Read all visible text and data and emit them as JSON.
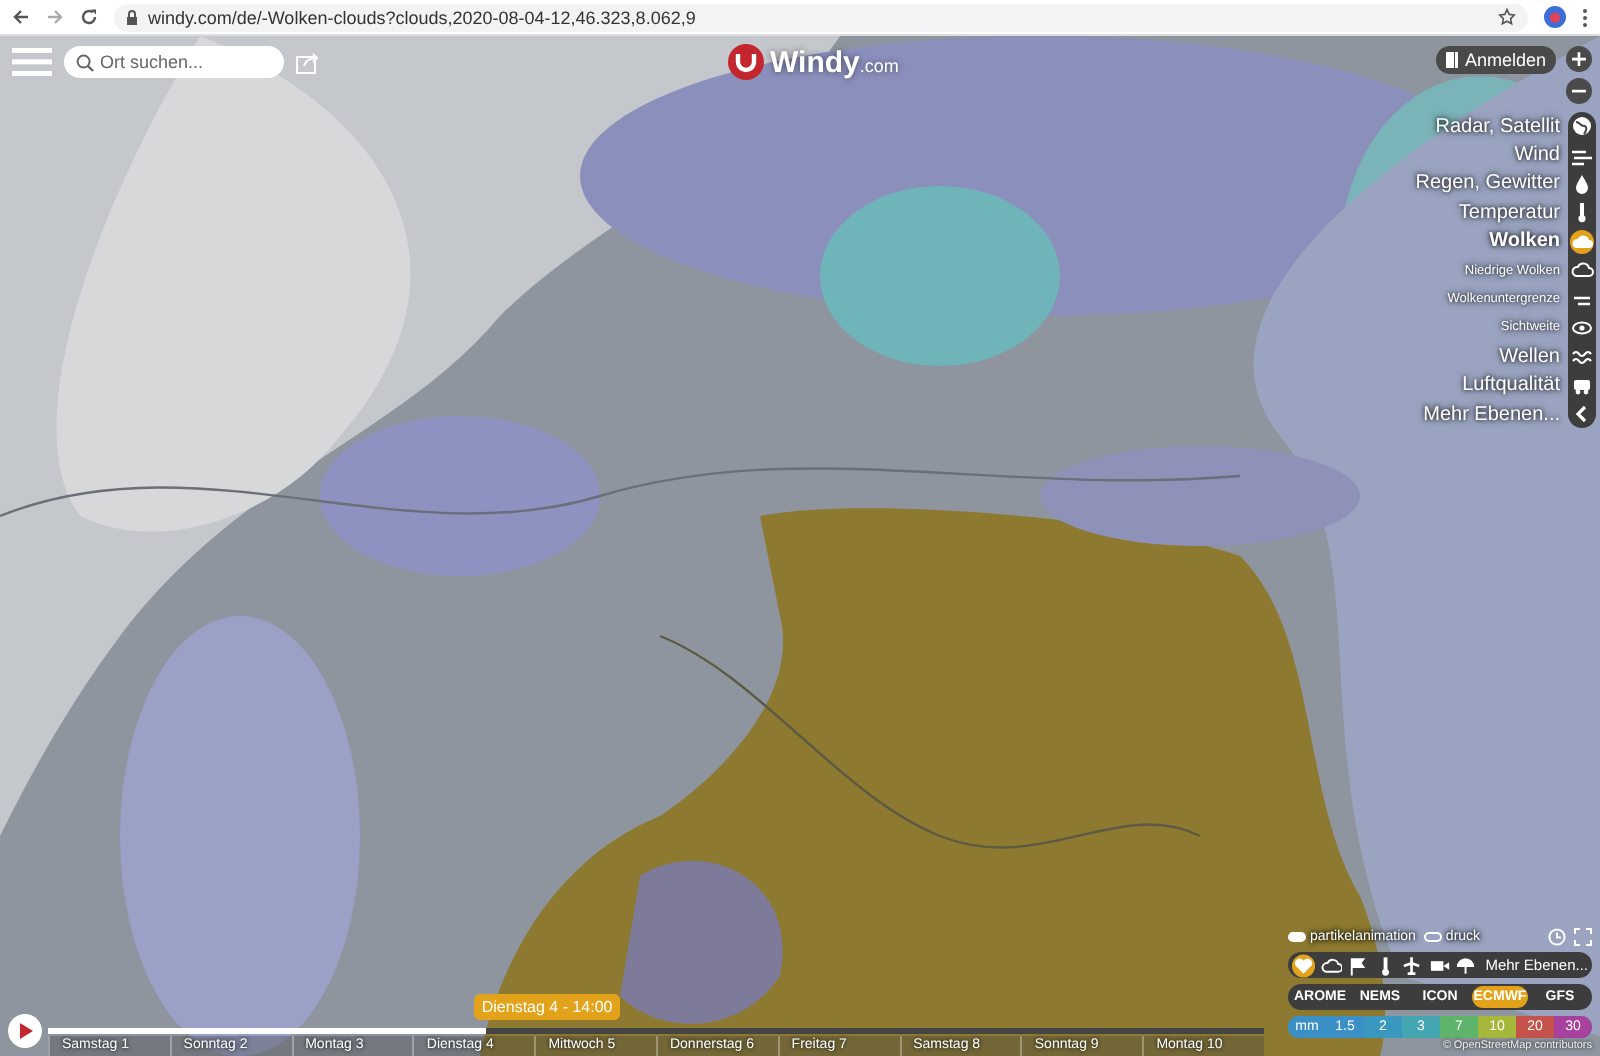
{
  "browser": {
    "url": "windy.com/de/-Wolken-clouds?clouds,2020-08-04-12,46.323,8.062,9"
  },
  "topbar": {
    "search": {
      "placeholder": "Ort suchen..."
    },
    "logo_name": "Windy",
    "logo_suffix": ".com",
    "login_button": "Anmelden",
    "zoom_in": "+",
    "zoom_out": "−"
  },
  "layers": [
    {
      "label": "Radar, Satellit",
      "kind": "major",
      "selected": false
    },
    {
      "label": "Wind",
      "kind": "major",
      "selected": false
    },
    {
      "label": "Regen, Gewitter",
      "kind": "major",
      "selected": false
    },
    {
      "label": "Temperatur",
      "kind": "major",
      "selected": false
    },
    {
      "label": "Wolken",
      "kind": "major",
      "selected": true
    },
    {
      "label": "Niedrige Wolken",
      "kind": "minor",
      "selected": false
    },
    {
      "label": "Wolkenuntergrenze",
      "kind": "minor",
      "selected": false
    },
    {
      "label": "Sichtweite",
      "kind": "minor",
      "selected": false
    },
    {
      "label": "Wellen",
      "kind": "major",
      "selected": false
    },
    {
      "label": "Luftqualität",
      "kind": "major",
      "selected": false
    },
    {
      "label": "Mehr Ebenen...",
      "kind": "major",
      "selected": false
    }
  ],
  "panel": {
    "toggles": [
      {
        "label": "partikelanimation",
        "on": true
      },
      {
        "label": "druck",
        "on": false
      }
    ],
    "shortcuts": [
      {
        "selected": true
      },
      {
        "selected": false
      },
      {
        "selected": false
      },
      {
        "selected": false
      },
      {
        "selected": false
      },
      {
        "selected": false
      },
      {
        "selected": false
      }
    ],
    "more_layers": "Mehr Ebenen...",
    "models": [
      {
        "label": "AROME",
        "selected": false
      },
      {
        "label": "NEMS",
        "selected": false
      },
      {
        "label": "ICON",
        "selected": false
      },
      {
        "label": "ECMWF",
        "selected": true
      },
      {
        "label": "GFS",
        "selected": false
      }
    ],
    "legend": {
      "unit": "mm",
      "steps": [
        {
          "label": "1.5",
          "color": "#3a8fc4"
        },
        {
          "label": "2",
          "color": "#3a97be"
        },
        {
          "label": "3",
          "color": "#44a6b0"
        },
        {
          "label": "7",
          "color": "#5db46a"
        },
        {
          "label": "10",
          "color": "#a6b83c"
        },
        {
          "label": "20",
          "color": "#c6524c"
        },
        {
          "label": "30",
          "color": "#a8409e"
        }
      ]
    },
    "attribution": "© OpenStreetMap contributors"
  },
  "timeline": {
    "current": "Dienstag 4 - 14:00",
    "level": 0.36,
    "days": [
      "Samstag 1",
      "Sonntag 2",
      "Montag 3",
      "Dienstag 4",
      "Mittwoch 5",
      "Donnerstag 6",
      "Freitag 7",
      "Samstag 8",
      "Sonntag 9",
      "Montag 10"
    ]
  }
}
